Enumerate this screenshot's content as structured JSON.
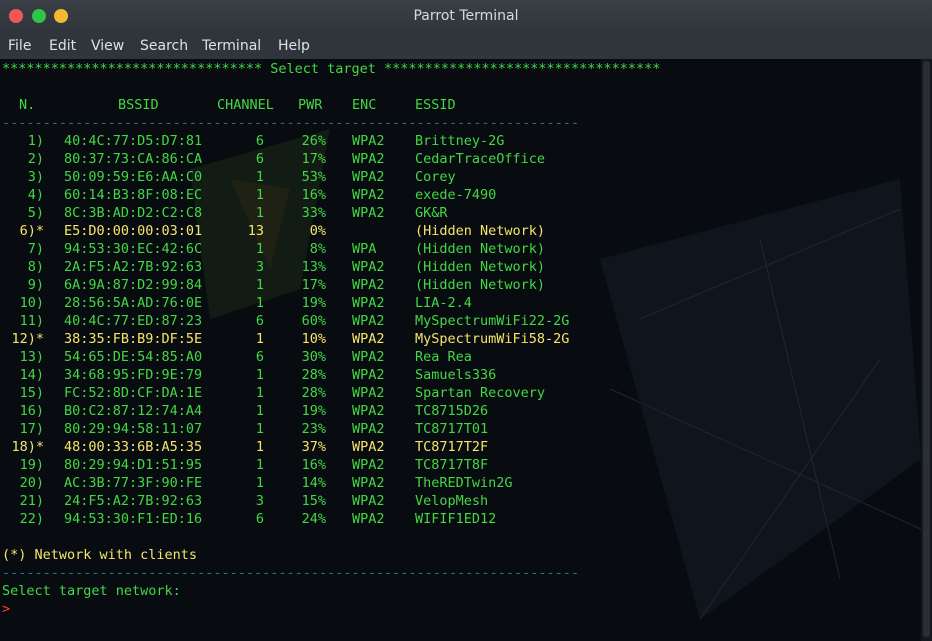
{
  "window": {
    "title": "Parrot Terminal",
    "controls": {
      "close": "close-icon",
      "minimize": "minimize-icon",
      "maximize": "maximize-icon"
    }
  },
  "menu": [
    "File",
    "Edit",
    "View",
    "Search",
    "Terminal",
    "Help"
  ],
  "terminal": {
    "header_line": "******************************** Select target **********************************",
    "columns": [
      "N.",
      "BSSID",
      "CHANNEL",
      "PWR",
      "ENC",
      "ESSID"
    ],
    "separator": "-----------------------------------------------------------------------",
    "rows": [
      {
        "n": "1)",
        "bssid": "40:4C:77:D5:D7:81",
        "channel": "6",
        "pwr": "26%",
        "enc": "WPA2",
        "essid": "Brittney-2G",
        "clients": false
      },
      {
        "n": "2)",
        "bssid": "80:37:73:CA:86:CA",
        "channel": "6",
        "pwr": "17%",
        "enc": "WPA2",
        "essid": "CedarTraceOffice",
        "clients": false
      },
      {
        "n": "3)",
        "bssid": "50:09:59:E6:AA:C0",
        "channel": "1",
        "pwr": "53%",
        "enc": "WPA2",
        "essid": "Corey",
        "clients": false
      },
      {
        "n": "4)",
        "bssid": "60:14:B3:8F:08:EC",
        "channel": "1",
        "pwr": "16%",
        "enc": "WPA2",
        "essid": "exede-7490",
        "clients": false
      },
      {
        "n": "5)",
        "bssid": "8C:3B:AD:D2:C2:C8",
        "channel": "1",
        "pwr": "33%",
        "enc": "WPA2",
        "essid": "GK&R",
        "clients": false
      },
      {
        "n": "6)*",
        "bssid": "E5:D0:00:00:03:01",
        "channel": "13",
        "pwr": "0%",
        "enc": "",
        "essid": "(Hidden Network)",
        "clients": true
      },
      {
        "n": "7)",
        "bssid": "94:53:30:EC:42:6C",
        "channel": "1",
        "pwr": "8%",
        "enc": "WPA",
        "essid": "(Hidden Network)",
        "clients": false
      },
      {
        "n": "8)",
        "bssid": "2A:F5:A2:7B:92:63",
        "channel": "3",
        "pwr": "13%",
        "enc": "WPA2",
        "essid": "(Hidden Network)",
        "clients": false
      },
      {
        "n": "9)",
        "bssid": "6A:9A:87:D2:99:84",
        "channel": "1",
        "pwr": "17%",
        "enc": "WPA2",
        "essid": "(Hidden Network)",
        "clients": false
      },
      {
        "n": "10)",
        "bssid": "28:56:5A:AD:76:0E",
        "channel": "1",
        "pwr": "19%",
        "enc": "WPA2",
        "essid": "LIA-2.4",
        "clients": false
      },
      {
        "n": "11)",
        "bssid": "40:4C:77:ED:87:23",
        "channel": "6",
        "pwr": "60%",
        "enc": "WPA2",
        "essid": "MySpectrumWiFi22-2G",
        "clients": false
      },
      {
        "n": "12)*",
        "bssid": "38:35:FB:B9:DF:5E",
        "channel": "1",
        "pwr": "10%",
        "enc": "WPA2",
        "essid": "MySpectrumWiFi58-2G",
        "clients": true
      },
      {
        "n": "13)",
        "bssid": "54:65:DE:54:85:A0",
        "channel": "6",
        "pwr": "30%",
        "enc": "WPA2",
        "essid": "Rea Rea",
        "clients": false
      },
      {
        "n": "14)",
        "bssid": "34:68:95:FD:9E:79",
        "channel": "1",
        "pwr": "28%",
        "enc": "WPA2",
        "essid": "Samuels336",
        "clients": false
      },
      {
        "n": "15)",
        "bssid": "FC:52:8D:CF:DA:1E",
        "channel": "1",
        "pwr": "28%",
        "enc": "WPA2",
        "essid": "Spartan Recovery",
        "clients": false
      },
      {
        "n": "16)",
        "bssid": "B0:C2:87:12:74:A4",
        "channel": "1",
        "pwr": "19%",
        "enc": "WPA2",
        "essid": "TC8715D26",
        "clients": false
      },
      {
        "n": "17)",
        "bssid": "80:29:94:58:11:07",
        "channel": "1",
        "pwr": "23%",
        "enc": "WPA2",
        "essid": "TC8717T01",
        "clients": false
      },
      {
        "n": "18)*",
        "bssid": "48:00:33:6B:A5:35",
        "channel": "1",
        "pwr": "37%",
        "enc": "WPA2",
        "essid": "TC8717T2F",
        "clients": true
      },
      {
        "n": "19)",
        "bssid": "80:29:94:D1:51:95",
        "channel": "1",
        "pwr": "16%",
        "enc": "WPA2",
        "essid": "TC8717T8F",
        "clients": false
      },
      {
        "n": "20)",
        "bssid": "AC:3B:77:3F:90:FE",
        "channel": "1",
        "pwr": "14%",
        "enc": "WPA2",
        "essid": "TheREDTwin2G",
        "clients": false
      },
      {
        "n": "21)",
        "bssid": "24:F5:A2:7B:92:63",
        "channel": "3",
        "pwr": "15%",
        "enc": "WPA2",
        "essid": "VelopMesh",
        "clients": false
      },
      {
        "n": "22)",
        "bssid": "94:53:30:F1:ED:16",
        "channel": "6",
        "pwr": "24%",
        "enc": "WPA2",
        "essid": "WIFIF1ED12",
        "clients": false
      }
    ],
    "legend": "(*) Network with clients",
    "prompt_label": "Select target network:",
    "prompt_symbol": ">"
  },
  "colors": {
    "text_green": "#43d843",
    "highlight_yellow": "#f5e56b",
    "separator_blue": "#2e6f8f",
    "prompt_red": "#ff3b30"
  }
}
